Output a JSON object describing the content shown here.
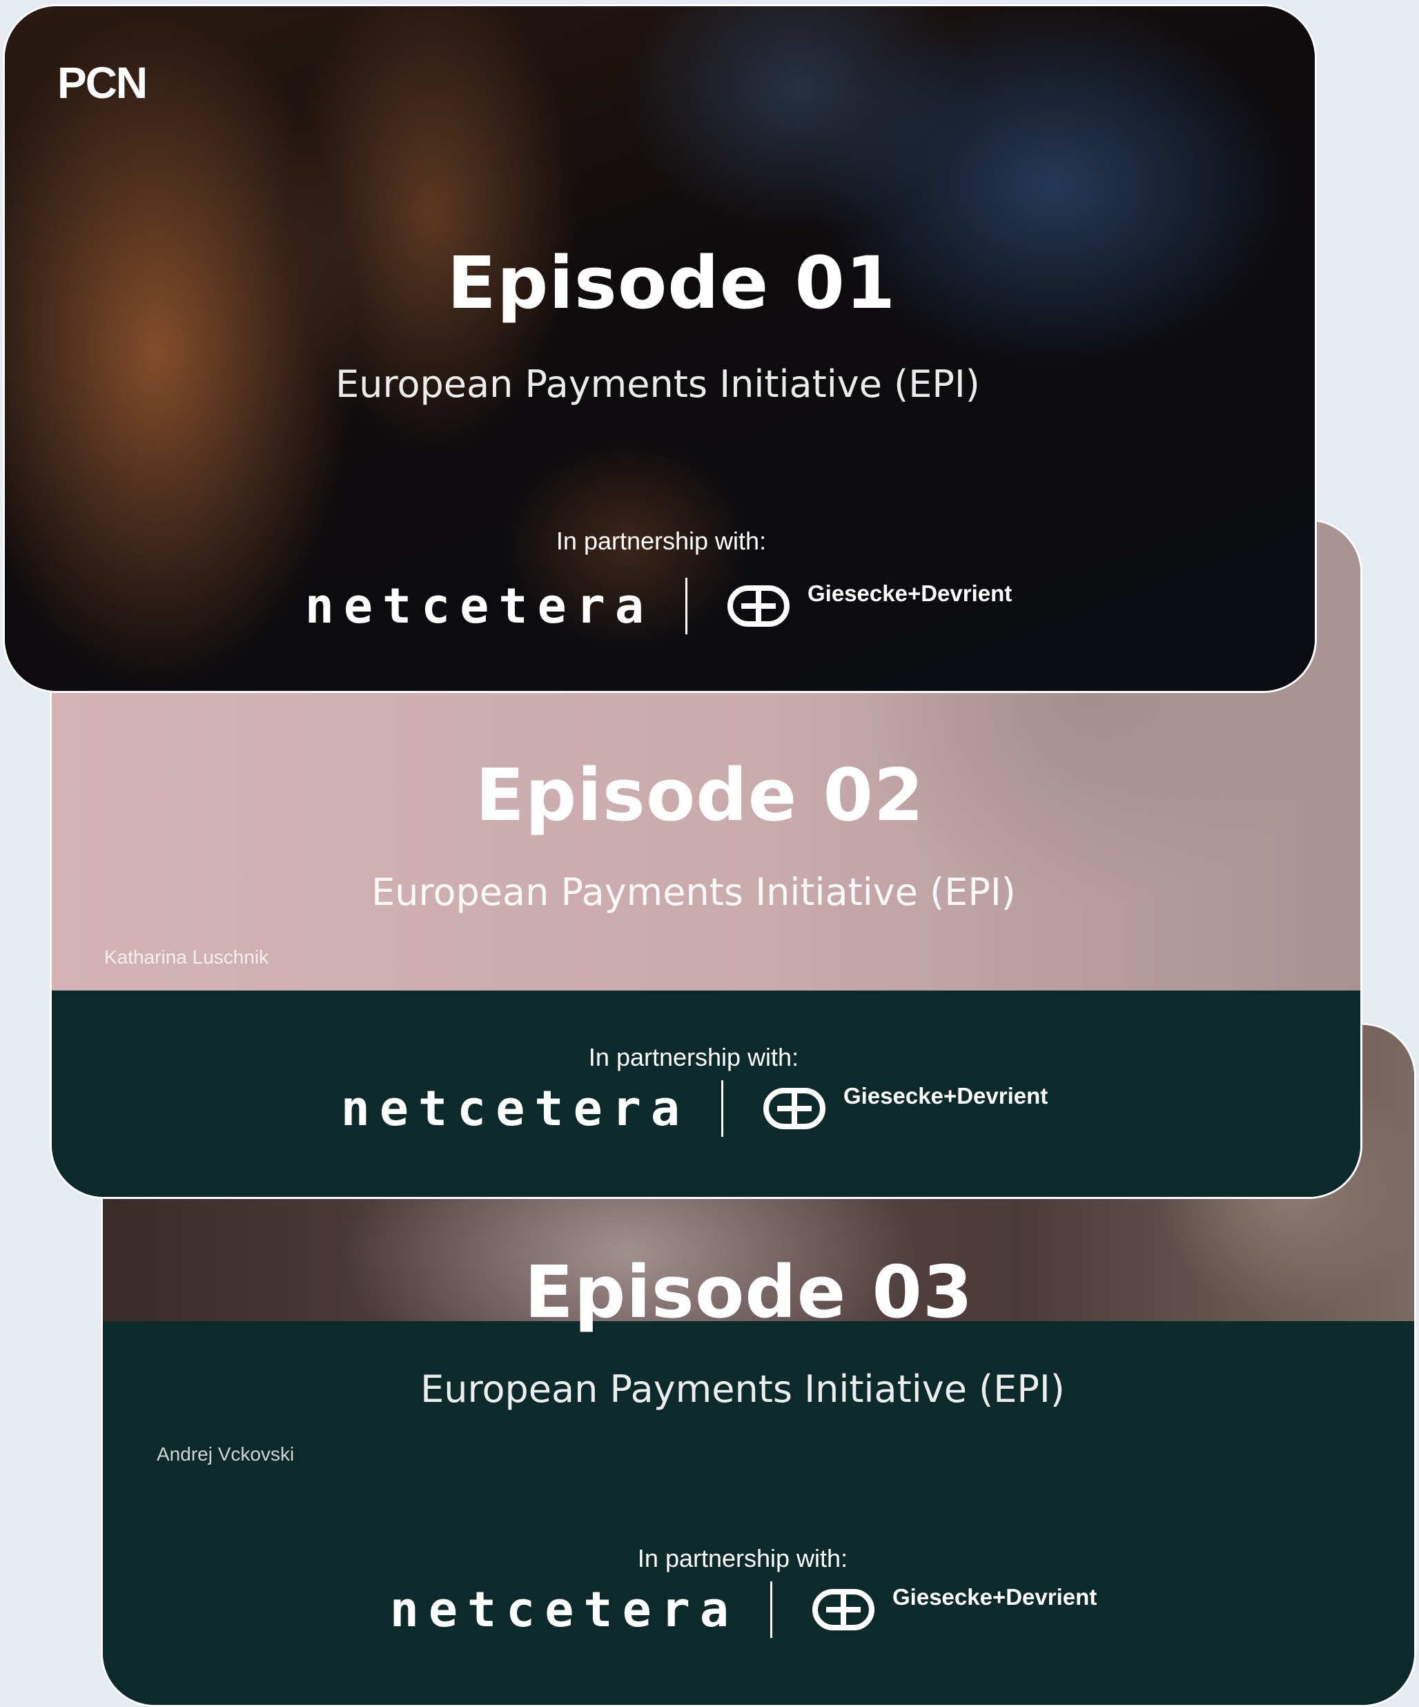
{
  "brand": "PCN",
  "episodes": [
    {
      "title": "Episode 01",
      "subtitle": "European Payments Initiative (EPI)",
      "speaker": "",
      "partnership_label": "In partnership with:",
      "partner_1": "netcetera",
      "partner_2": "Giesecke+Devrient"
    },
    {
      "title": "Episode 02",
      "subtitle": "European Payments Initiative (EPI)",
      "speaker": "Katharina Luschnik",
      "partnership_label": "In partnership with:",
      "partner_1": "netcetera",
      "partner_2": "Giesecke+Devrient"
    },
    {
      "title": "Episode 03",
      "subtitle": "European Payments Initiative (EPI)",
      "speaker": "Andrej Vckovski",
      "partnership_label": "In partnership with:",
      "partner_1": "netcetera",
      "partner_2": "Giesecke+Devrient"
    }
  ],
  "colors": {
    "page_background": "#e6ebf1",
    "teal_band": "#0c2a29",
    "text": "#ffffff"
  },
  "icons": [
    "gd-logo-icon"
  ]
}
